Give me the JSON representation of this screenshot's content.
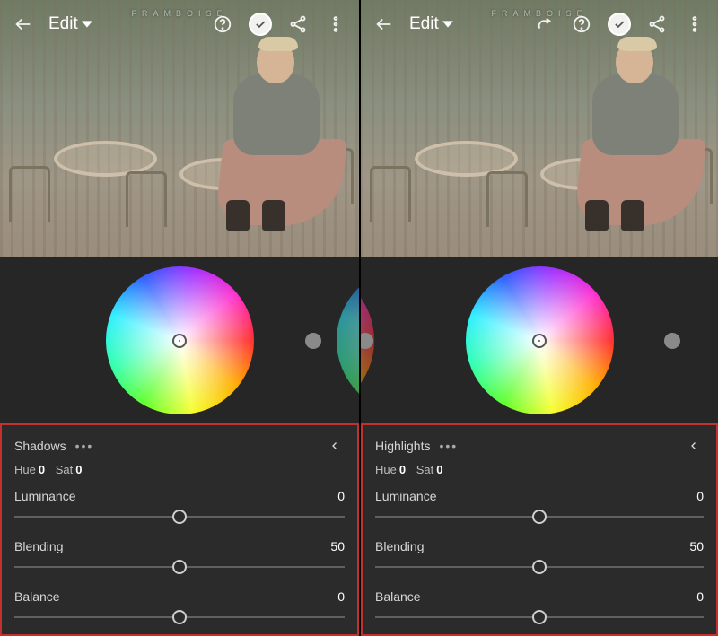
{
  "watermark": "FRAMBOISE",
  "topbar": {
    "edit_label": "Edit"
  },
  "left": {
    "panel_title": "Shadows",
    "hue_label": "Hue",
    "hue_value": "0",
    "sat_label": "Sat",
    "sat_value": "0",
    "sliders": {
      "luminance": {
        "label": "Luminance",
        "value": "0",
        "percent": 50
      },
      "blending": {
        "label": "Blending",
        "value": "50",
        "percent": 50
      },
      "balance": {
        "label": "Balance",
        "value": "0",
        "percent": 50
      }
    }
  },
  "right": {
    "panel_title": "Highlights",
    "hue_label": "Hue",
    "hue_value": "0",
    "sat_label": "Sat",
    "sat_value": "0",
    "sliders": {
      "luminance": {
        "label": "Luminance",
        "value": "0",
        "percent": 50
      },
      "blending": {
        "label": "Blending",
        "value": "50",
        "percent": 50
      },
      "balance": {
        "label": "Balance",
        "value": "0",
        "percent": 50
      }
    }
  }
}
